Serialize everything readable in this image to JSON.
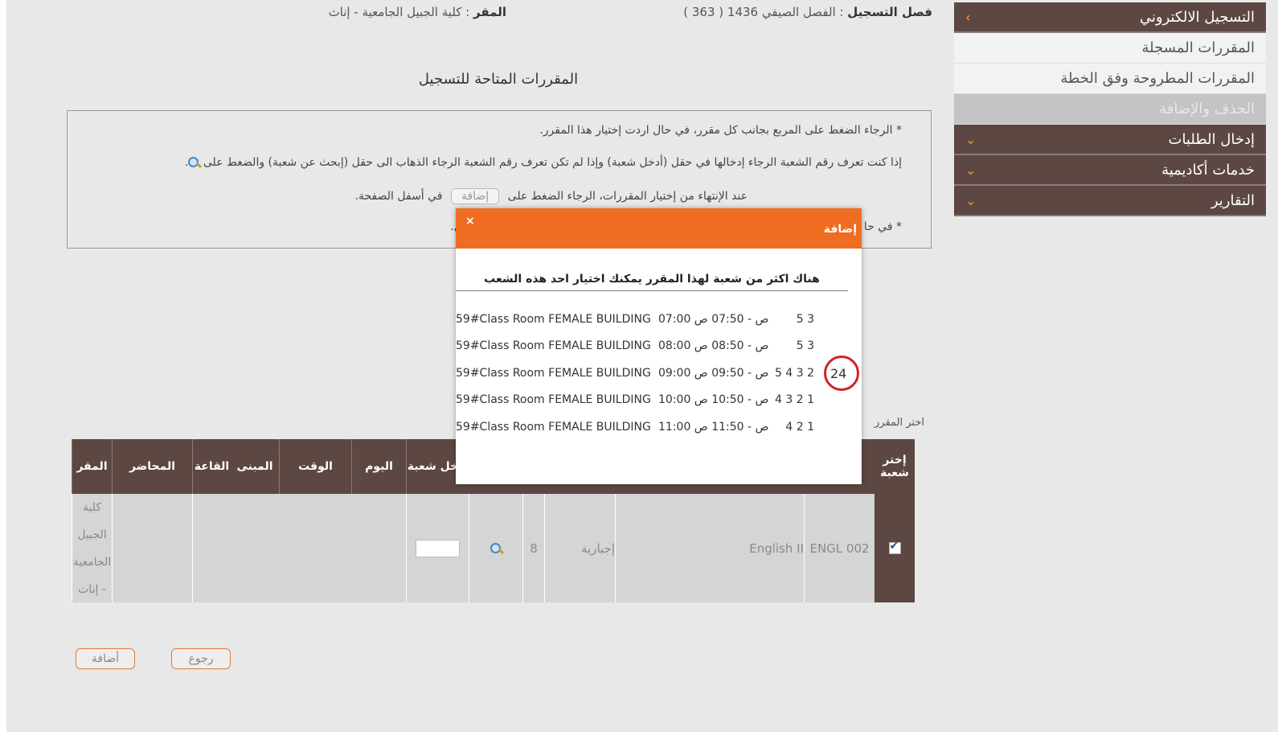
{
  "sidebar": {
    "items": [
      {
        "label": "التسجيل الالكتروني",
        "chevron": "›",
        "type": "head"
      },
      {
        "label": "المقررات المسجلة",
        "type": "sub"
      },
      {
        "label": "المقررات المطروحة وفق الخطة",
        "type": "sub"
      },
      {
        "label": "الحذف والإضافة",
        "type": "sub-active"
      },
      {
        "label": "إدخال الطلبات",
        "chevron": "⌄",
        "type": "head"
      },
      {
        "label": "خدمات أكاديمية",
        "chevron": "⌄",
        "type": "head"
      },
      {
        "label": "التقارير",
        "chevron": "⌄",
        "type": "head"
      }
    ]
  },
  "header": {
    "term_label": "فصل التسجيل",
    "term_value": ": الفصل الصيفي 1436 ( 363 )",
    "site_label": "المقر",
    "site_value": ": كلية الجبيل الجامعية - إناث"
  },
  "page_title": "المقررات المتاحة للتسجيل",
  "instructions": {
    "line1": "* الرجاء الضغط على المربع بجانب كل مقرر، في حال اردت إختيار هذا المقرر.",
    "line2": "إذا كنت تعرف رقم الشعبة الرجاء إدخالها في حقل (أدخل شعبة) وإذا لم تكن تعرف رقم الشعبة الرجاء الذهاب الى حقل (إبحث عن شعبة) والضغط على",
    "line2_end": ".",
    "line3_a": "عند الإنتهاء من إختيار المقررات، الرجاء الضغط على",
    "line3_btn": "إضافة",
    "line3_b": "في أسفل الصفحة.",
    "line4_a": "* في حا",
    "line4_b": "فل."
  },
  "choose_label": "اختر المقرر",
  "table": {
    "headers": {
      "select": "إختر شعبة",
      "site": "المقر",
      "lecturer": "المحاضر",
      "hall": "القاعة",
      "building": "المبنى",
      "time": "الوقت",
      "day": "اليوم",
      "enter_section": "أدخل شعبة"
    },
    "row": {
      "code": "ENGL 002",
      "name": "English II",
      "type": "إجبارية",
      "hours": "8",
      "site": "كلية الجبيل الجامعية - إناث"
    }
  },
  "buttons": {
    "add": "أضافة",
    "back": "رجوع"
  },
  "modal": {
    "title": "إضافة",
    "close": "×",
    "message": "هناك اكثر من شعبة لهذا المقرر يمكنك اختيار احد هذه الشعب",
    "sections": [
      {
        "section": "",
        "days": "5 3",
        "time": "07:00 ص - 07:50 ص",
        "room": "59#Class Room FEMALE BUILDING"
      },
      {
        "section": "",
        "days": "5 3",
        "time": "08:00 ص - 08:50 ص",
        "room": "59#Class Room FEMALE BUILDING"
      },
      {
        "section": "24",
        "days": "5 4 3 2",
        "time": "09:00 ص - 09:50 ص",
        "room": "59#Class Room FEMALE BUILDING"
      },
      {
        "section": "",
        "days": "4 3 2 1",
        "time": "10:00 ص - 10:50 ص",
        "room": "59#Class Room FEMALE BUILDING"
      },
      {
        "section": "",
        "days": "4 2 1",
        "time": "11:00 ص - 11:50 ص",
        "room": "59#Class Room FEMALE BUILDING"
      }
    ]
  },
  "colors": {
    "sidebar_head": "#5c4742",
    "modal_header": "#ef6d21",
    "highlight_circle": "#d3202a"
  }
}
